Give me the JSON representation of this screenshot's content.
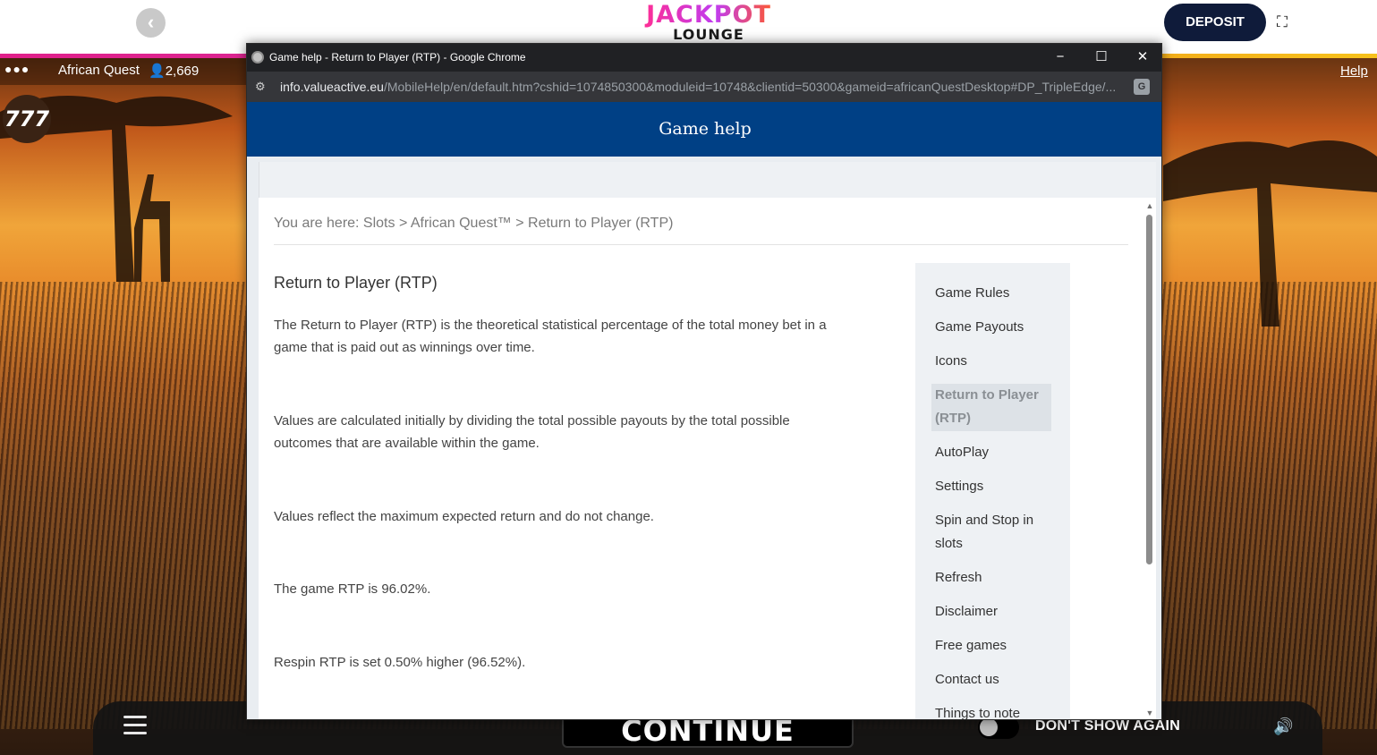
{
  "site": {
    "logo_top": "JACKPOT",
    "logo_bottom": "LOUNGE",
    "deposit_label": "DEPOSIT"
  },
  "game": {
    "name": "African Quest",
    "players": "2,669",
    "help_link": "Help",
    "badge": "777",
    "continue_label": "CONTINUE",
    "dont_show_label": "DON'T SHOW AGAIN"
  },
  "popup": {
    "window_title": "Game help - Return to Player (RTP) - Google Chrome",
    "url_host": "info.valueactive.eu",
    "url_path": "/MobileHelp/en/default.htm?cshid=1074850300&moduleid=10748&clientid=50300&gameid=africanQuestDesktop#DP_TripleEdge/...",
    "header_title": "Game help",
    "breadcrumb": "You are here: Slots > African Quest™ > Return to Player (RTP)",
    "page_title": "Return to Player (RTP)",
    "paragraphs": [
      "The Return to Player (RTP) is the theoretical statistical percentage of the total money bet in a game that is paid out as winnings over time.",
      "Values are calculated initially by dividing the total possible payouts by the total possible outcomes that are available within the game.",
      "Values reflect the maximum expected return and do not change.",
      "The game RTP is 96.02%.",
      "Respin RTP is set 0.50% higher (96.52%)."
    ],
    "nav": [
      "Game Rules",
      "Game Payouts",
      "Icons",
      "Return to Player (RTP)",
      "AutoPlay",
      "Settings",
      "Spin and Stop in slots",
      "Refresh",
      "Disclaimer",
      "Free games",
      "Contact us",
      "Things to note"
    ]
  }
}
